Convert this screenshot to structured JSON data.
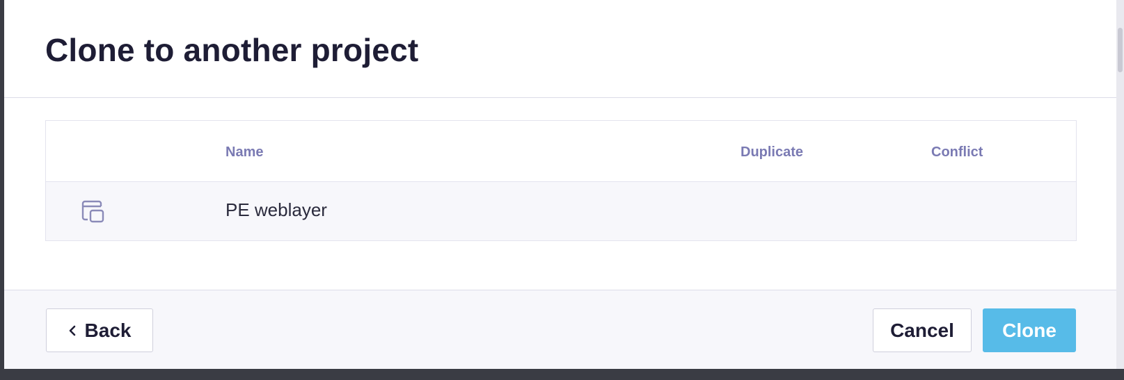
{
  "dialog": {
    "title": "Clone to another project"
  },
  "table": {
    "columns": [
      "Name",
      "Duplicate",
      "Conflict"
    ],
    "rows": [
      {
        "icon": "window-copy-icon",
        "name": "PE weblayer",
        "duplicate": "",
        "conflict": ""
      }
    ]
  },
  "footer": {
    "back_label": "Back",
    "cancel_label": "Cancel",
    "clone_label": "Clone"
  },
  "colors": {
    "accent": "#57bbe8",
    "title": "#1e1d35",
    "header_text": "#7a7ab3",
    "row_bg": "#f7f7fb"
  }
}
